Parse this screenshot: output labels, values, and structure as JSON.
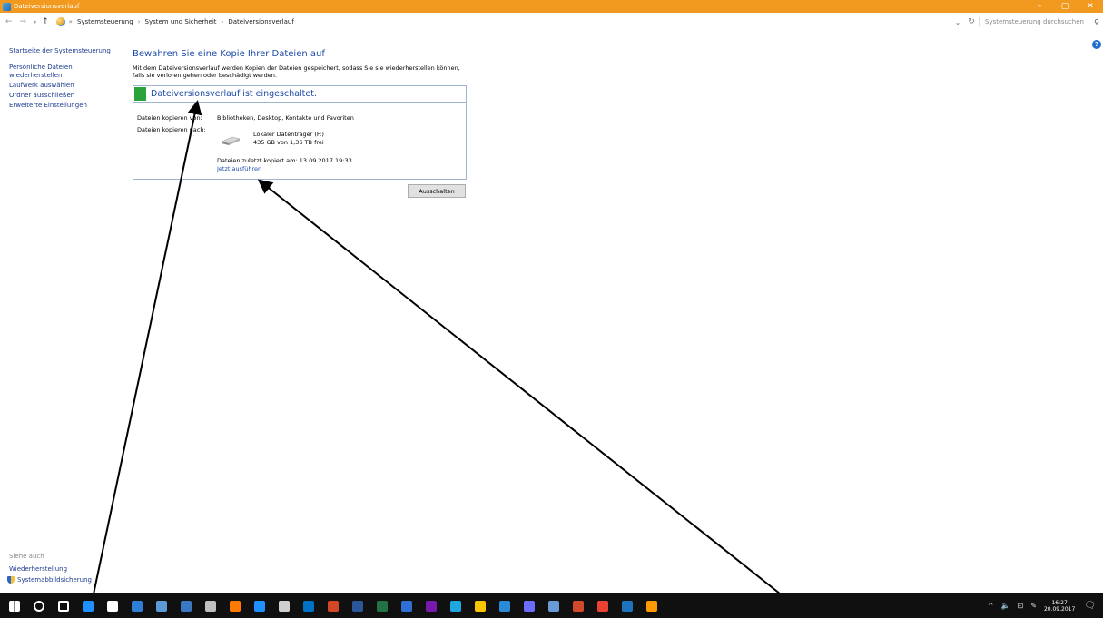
{
  "window": {
    "title": "Dateiversionsverlauf",
    "controls": {
      "minimize": "–",
      "maximize": "▢",
      "close": "✕"
    }
  },
  "address": {
    "crumbs": [
      "Systemsteuerung",
      "System und Sicherheit",
      "Dateiversionsverlauf"
    ],
    "search_placeholder": "Systemsteuerung durchsuchen"
  },
  "sidebar": {
    "items": [
      "Startseite der Systemsteuerung",
      "Persönliche Dateien wiederherstellen",
      "Laufwerk auswählen",
      "Ordner ausschließen",
      "Erweiterte Einstellungen"
    ],
    "see_also": {
      "heading": "Siehe auch",
      "items": [
        "Wiederherstellung",
        "Systemabbildsicherung"
      ]
    }
  },
  "main": {
    "title": "Bewahren Sie eine Kopie Ihrer Dateien auf",
    "description_line1": "Mit dem Dateiversionsverlauf werden Kopien der Dateien gespeichert, sodass Sie sie wiederherstellen können,",
    "description_line2": "falls sie verloren gehen oder beschädigt werden.",
    "status": "Dateiversionsverlauf ist eingeschaltet.",
    "copy_from_label": "Dateien kopieren von:",
    "copy_from_value": "Bibliotheken, Desktop, Kontakte und Favoriten",
    "copy_to_label": "Dateien kopieren nach:",
    "drive_name": "Lokaler Datenträger (F:)",
    "drive_space": "435 GB von 1,36 TB frei",
    "last_copy": "Dateien zuletzt kopiert am: 13.09.2017 19:33",
    "run_now": "Jetzt ausführen",
    "off_button": "Ausschalten"
  },
  "taskbar": {
    "time": "16:27",
    "date": "20.09.2017",
    "icon_colors": [
      "#ffffff",
      "#ffffff",
      "#ffffff",
      "#1e90ff",
      "#ffffff",
      "#2f7ed8",
      "#5b9bd5",
      "#3a78c2",
      "#c0c0c0",
      "#ff7a00",
      "#1e90ff",
      "#cfcfcf",
      "#0072c6",
      "#d24726",
      "#2b579a",
      "#217346",
      "#2f6fd6",
      "#7719aa",
      "#1fa8e0",
      "#f7c600",
      "#2b8ad6",
      "#6c6cff",
      "#6a9bd8",
      "#d14a2b",
      "#ea4335",
      "#1e73be",
      "#ff9900"
    ]
  },
  "colors": {
    "titlebar": "#f29a1f",
    "link": "#1e3d8f",
    "status_green": "#2aa33a",
    "heading_blue": "#1e4aa8"
  }
}
